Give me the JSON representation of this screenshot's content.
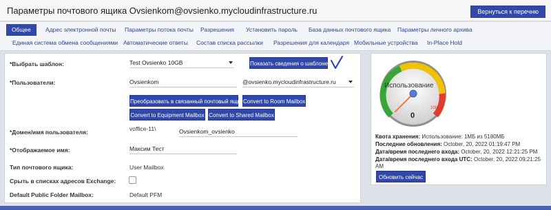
{
  "header": {
    "title": "Параметры почтового ящика Ovsienkom@ovsienko.mycloudinfrastructure.ru",
    "back_button": "Вернуться к перечню"
  },
  "tabs_row1": [
    "Общее",
    "Адрес электронной почты",
    "Параметры потока почты",
    "Разрешения",
    "Установить пароль",
    "База данных почтового ящика",
    "Параметры личного архива"
  ],
  "tabs_row2": [
    "Единая система обмена сообщениями",
    "Автоматические ответы",
    "Состав списка рассылки",
    "Разрешения для календаря",
    "Мобильные устройства",
    "In-Place Hold"
  ],
  "form": {
    "template_label": "*Выбрать шаблон:",
    "template_value": "Test Ovsienko 10GB",
    "show_template_button": "Показать сведения о шаблоне",
    "users_label": "*Пользователи:",
    "users_value": "Ovsienkom",
    "domain_select_value": "@ovsienko.mycloudinfrastructure.ru",
    "btn_convert_linked": "Преобразовать в связанный почтовый ящик",
    "btn_convert_room": "Convert to Room Mailbox",
    "btn_convert_equipment": "Convert to Equipment Mailbox",
    "btn_convert_shared": "Convert to Shared Mailbox",
    "domain_user_label": "*Домен/имя пользователя:",
    "domain_prefix": "voffice-11\\",
    "domain_user_value": "Ovsienkom_ovsienko",
    "display_name_label": "*Отображаемое имя:",
    "display_name_value": "Максим Тест",
    "mailbox_type_label": "Тип почтового ящика:",
    "mailbox_type_value": "User Mailbox",
    "hide_label": "Срыть в списках адресов Exchange:",
    "default_pf_label": "Default Public Folder Mailbox:",
    "default_pf_value": "Default PFM"
  },
  "quota": {
    "gauge_label": "Использование",
    "gauge_value": "0",
    "gauge_mark": "100",
    "usage_percent": 0,
    "quota_label": "Квота хранения:",
    "quota_value": "Использование: 1МБ из 5180МБ",
    "last_update_label": "Последние обновления:",
    "last_update_value": "October, 20, 2022 01:19:47 PM",
    "last_login_label": "Дата/время последнего входа:",
    "last_login_value": "October, 20, 2022 12:21:25 PM",
    "last_login_utc_label": "Дата/время последнего входа UTC:",
    "last_login_utc_value": "October, 20, 2022 09:21:25",
    "last_login_utc_value2": "AM",
    "refresh_button": "Обновить сейчас"
  },
  "colors": {
    "accent": "#2f48a9",
    "gauge_green": "#3aa537",
    "gauge_yellow": "#f2c200",
    "gauge_red": "#e23b2e",
    "needle": "#f47c32",
    "checkmark": "#1f3ccc"
  },
  "icons": [
    "chevron-down-icon",
    "checkmark-icon"
  ]
}
